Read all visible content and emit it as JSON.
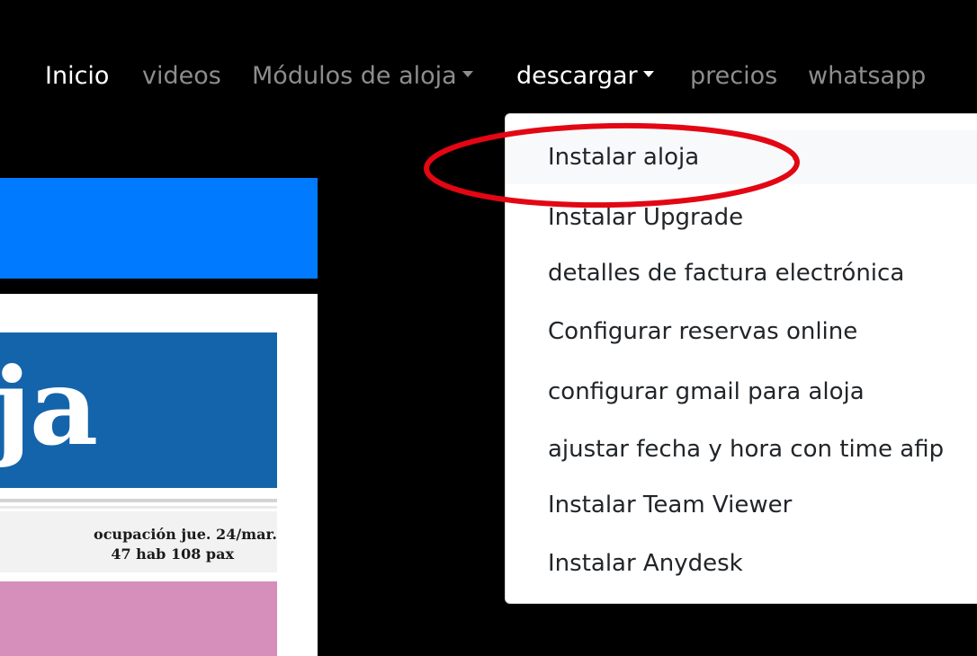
{
  "nav": {
    "items": [
      {
        "label": "Inicio",
        "state": "active"
      },
      {
        "label": "videos",
        "state": "muted"
      },
      {
        "label": "Módulos de aloja",
        "state": "muted",
        "dropdown": true
      },
      {
        "label": "descargar",
        "state": "active",
        "dropdown": true
      },
      {
        "label": "precios",
        "state": "muted"
      },
      {
        "label": "whatsapp",
        "state": "muted"
      }
    ]
  },
  "dropdown": {
    "items": [
      "Instalar aloja",
      "Instalar Upgrade",
      "detalles de factura electrónica",
      "Configurar reservas online",
      "configurar gmail para aloja",
      "ajustar fecha y hora con time afip",
      "Instalar Team Viewer",
      "Instalar Anydesk"
    ],
    "highlighted": "Instalar aloja"
  },
  "thumbnail": {
    "logo_text": "ja",
    "occupancy_line1": "ocupación jue. 24/mar.",
    "occupancy_line2": "47 hab 108 pax"
  },
  "colors": {
    "nav_bg": "#000000",
    "blue_bar": "#007bff",
    "logo_bg": "#1464ab",
    "pink": "#d58fba",
    "annotation_circle": "#e30613"
  }
}
